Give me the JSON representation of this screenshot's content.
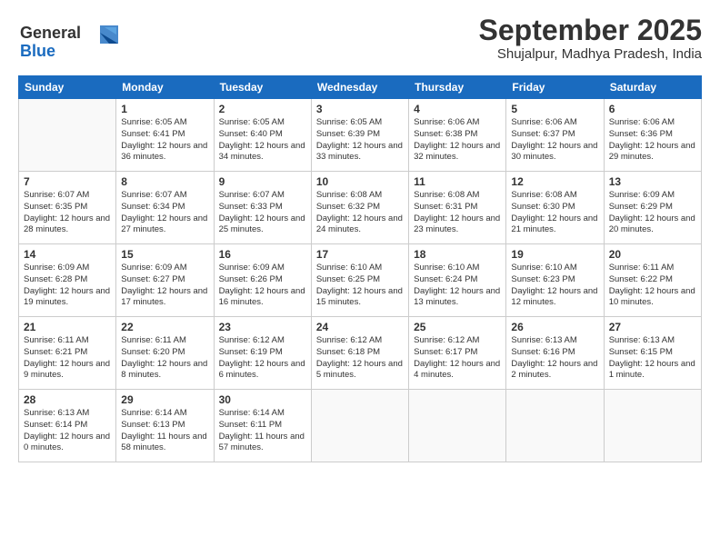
{
  "logo": {
    "line1": "General",
    "line2": "Blue"
  },
  "title": "September 2025",
  "location": "Shujalpur, Madhya Pradesh, India",
  "weekdays": [
    "Sunday",
    "Monday",
    "Tuesday",
    "Wednesday",
    "Thursday",
    "Friday",
    "Saturday"
  ],
  "weeks": [
    [
      {
        "day": "",
        "info": ""
      },
      {
        "day": "1",
        "info": "Sunrise: 6:05 AM\nSunset: 6:41 PM\nDaylight: 12 hours\nand 36 minutes."
      },
      {
        "day": "2",
        "info": "Sunrise: 6:05 AM\nSunset: 6:40 PM\nDaylight: 12 hours\nand 34 minutes."
      },
      {
        "day": "3",
        "info": "Sunrise: 6:05 AM\nSunset: 6:39 PM\nDaylight: 12 hours\nand 33 minutes."
      },
      {
        "day": "4",
        "info": "Sunrise: 6:06 AM\nSunset: 6:38 PM\nDaylight: 12 hours\nand 32 minutes."
      },
      {
        "day": "5",
        "info": "Sunrise: 6:06 AM\nSunset: 6:37 PM\nDaylight: 12 hours\nand 30 minutes."
      },
      {
        "day": "6",
        "info": "Sunrise: 6:06 AM\nSunset: 6:36 PM\nDaylight: 12 hours\nand 29 minutes."
      }
    ],
    [
      {
        "day": "7",
        "info": "Sunrise: 6:07 AM\nSunset: 6:35 PM\nDaylight: 12 hours\nand 28 minutes."
      },
      {
        "day": "8",
        "info": "Sunrise: 6:07 AM\nSunset: 6:34 PM\nDaylight: 12 hours\nand 27 minutes."
      },
      {
        "day": "9",
        "info": "Sunrise: 6:07 AM\nSunset: 6:33 PM\nDaylight: 12 hours\nand 25 minutes."
      },
      {
        "day": "10",
        "info": "Sunrise: 6:08 AM\nSunset: 6:32 PM\nDaylight: 12 hours\nand 24 minutes."
      },
      {
        "day": "11",
        "info": "Sunrise: 6:08 AM\nSunset: 6:31 PM\nDaylight: 12 hours\nand 23 minutes."
      },
      {
        "day": "12",
        "info": "Sunrise: 6:08 AM\nSunset: 6:30 PM\nDaylight: 12 hours\nand 21 minutes."
      },
      {
        "day": "13",
        "info": "Sunrise: 6:09 AM\nSunset: 6:29 PM\nDaylight: 12 hours\nand 20 minutes."
      }
    ],
    [
      {
        "day": "14",
        "info": "Sunrise: 6:09 AM\nSunset: 6:28 PM\nDaylight: 12 hours\nand 19 minutes."
      },
      {
        "day": "15",
        "info": "Sunrise: 6:09 AM\nSunset: 6:27 PM\nDaylight: 12 hours\nand 17 minutes."
      },
      {
        "day": "16",
        "info": "Sunrise: 6:09 AM\nSunset: 6:26 PM\nDaylight: 12 hours\nand 16 minutes."
      },
      {
        "day": "17",
        "info": "Sunrise: 6:10 AM\nSunset: 6:25 PM\nDaylight: 12 hours\nand 15 minutes."
      },
      {
        "day": "18",
        "info": "Sunrise: 6:10 AM\nSunset: 6:24 PM\nDaylight: 12 hours\nand 13 minutes."
      },
      {
        "day": "19",
        "info": "Sunrise: 6:10 AM\nSunset: 6:23 PM\nDaylight: 12 hours\nand 12 minutes."
      },
      {
        "day": "20",
        "info": "Sunrise: 6:11 AM\nSunset: 6:22 PM\nDaylight: 12 hours\nand 10 minutes."
      }
    ],
    [
      {
        "day": "21",
        "info": "Sunrise: 6:11 AM\nSunset: 6:21 PM\nDaylight: 12 hours\nand 9 minutes."
      },
      {
        "day": "22",
        "info": "Sunrise: 6:11 AM\nSunset: 6:20 PM\nDaylight: 12 hours\nand 8 minutes."
      },
      {
        "day": "23",
        "info": "Sunrise: 6:12 AM\nSunset: 6:19 PM\nDaylight: 12 hours\nand 6 minutes."
      },
      {
        "day": "24",
        "info": "Sunrise: 6:12 AM\nSunset: 6:18 PM\nDaylight: 12 hours\nand 5 minutes."
      },
      {
        "day": "25",
        "info": "Sunrise: 6:12 AM\nSunset: 6:17 PM\nDaylight: 12 hours\nand 4 minutes."
      },
      {
        "day": "26",
        "info": "Sunrise: 6:13 AM\nSunset: 6:16 PM\nDaylight: 12 hours\nand 2 minutes."
      },
      {
        "day": "27",
        "info": "Sunrise: 6:13 AM\nSunset: 6:15 PM\nDaylight: 12 hours\nand 1 minute."
      }
    ],
    [
      {
        "day": "28",
        "info": "Sunrise: 6:13 AM\nSunset: 6:14 PM\nDaylight: 12 hours\nand 0 minutes."
      },
      {
        "day": "29",
        "info": "Sunrise: 6:14 AM\nSunset: 6:13 PM\nDaylight: 11 hours\nand 58 minutes."
      },
      {
        "day": "30",
        "info": "Sunrise: 6:14 AM\nSunset: 6:11 PM\nDaylight: 11 hours\nand 57 minutes."
      },
      {
        "day": "",
        "info": ""
      },
      {
        "day": "",
        "info": ""
      },
      {
        "day": "",
        "info": ""
      },
      {
        "day": "",
        "info": ""
      }
    ]
  ]
}
